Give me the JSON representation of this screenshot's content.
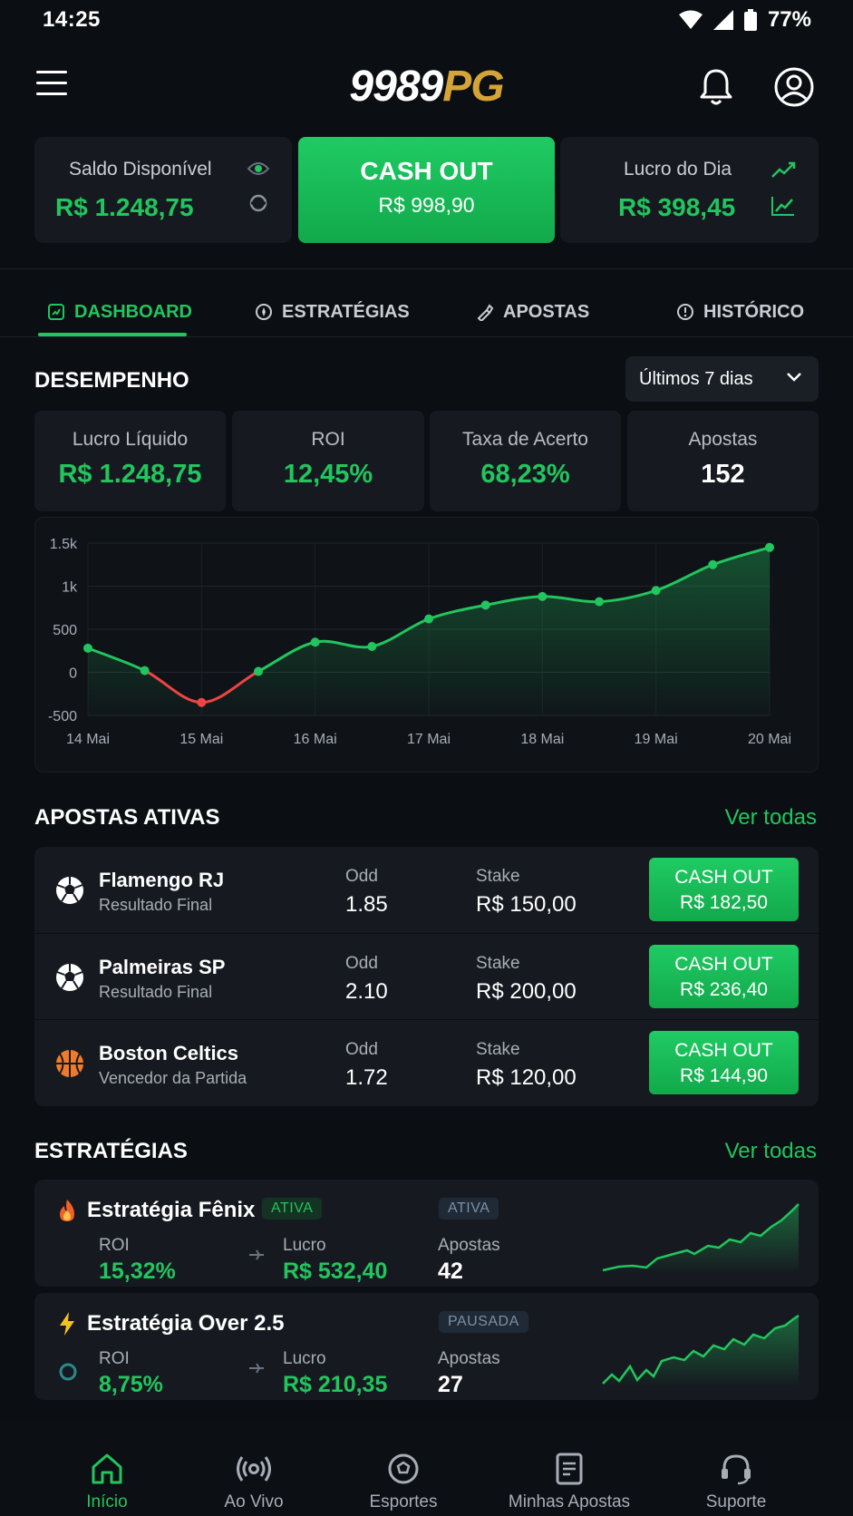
{
  "status": {
    "time": "14:25",
    "battery": "77%"
  },
  "header": {
    "logo_main": "9989",
    "logo_accent": "PG"
  },
  "top_cards": {
    "saldo_label": "Saldo Disponível",
    "saldo_value": "R$ 1.248,75",
    "cashout_label": "CASH OUT",
    "cashout_value": "R$ 998,90",
    "lucro_label": "Lucro do Dia",
    "lucro_value": "R$ 398,45"
  },
  "tabs": [
    {
      "label": "DASHBOARD",
      "active": true
    },
    {
      "label": "ESTRATÉGIAS"
    },
    {
      "label": "APOSTAS"
    },
    {
      "label": "HISTÓRICO"
    }
  ],
  "performance": {
    "title": "DESEMPENHO",
    "period": "Últimos 7 dias",
    "stats": [
      {
        "label": "Lucro Líquido",
        "value": "R$ 1.248,75",
        "color": "#22c55e"
      },
      {
        "label": "ROI",
        "value": "12,45%",
        "color": "#22c55e"
      },
      {
        "label": "Taxa de Acerto",
        "value": "68,23%",
        "color": "#22c55e"
      },
      {
        "label": "Apostas",
        "value": "152",
        "color": "#ffffff"
      }
    ]
  },
  "chart_data": {
    "type": "area",
    "title": "",
    "xlabel": "",
    "ylabel": "",
    "ylim": [
      -500,
      1500
    ],
    "yticks": [
      "1.5k",
      "1k",
      "500",
      "0",
      "-500"
    ],
    "ytick_values": [
      1500,
      1000,
      500,
      0,
      -500
    ],
    "x_tick_labels": [
      "14 Mai",
      "15 Mai",
      "16 Mai",
      "17 Mai",
      "18 Mai",
      "19 Mai",
      "20 Mai"
    ],
    "x": [
      0,
      0.5,
      1,
      1.5,
      2,
      2.5,
      3,
      3.5,
      4,
      4.5,
      5,
      5.5,
      6
    ],
    "values": [
      280,
      20,
      -350,
      10,
      350,
      300,
      620,
      780,
      880,
      820,
      950,
      1250,
      1450
    ],
    "colors": {
      "positive": "#22c55e",
      "negative": "#ef4444"
    },
    "grid": true
  },
  "active_bets": {
    "title": "APOSTAS ATIVAS",
    "see_all": "Ver todas",
    "odd_label": "Odd",
    "stake_label": "Stake",
    "items": [
      {
        "team": "Flamengo RJ",
        "market": "Resultado Final",
        "odd": "1.85",
        "stake": "R$ 150,00",
        "btn": "CASH OUT",
        "btn_value": "R$ 182,50",
        "icon": "soccer-ball-icon"
      },
      {
        "team": "Palmeiras SP",
        "market": "Resultado Final",
        "odd": "2.10",
        "stake": "R$ 200,00",
        "btn": "CASH OUT",
        "btn_value": "R$ 236,40",
        "icon": "soccer-ball-icon"
      },
      {
        "team": "Boston Celtics",
        "market": "Vencedor da Partida",
        "odd": "1.72",
        "stake": "R$ 120,00",
        "btn": "CASH OUT",
        "btn_value": "R$ 144,90",
        "icon": "basketball-icon"
      }
    ]
  },
  "strategies": {
    "title": "ESTRATÉGIAS",
    "see_all": "Ver todas",
    "roi_label": "ROI",
    "lucro_label": "Lucro",
    "apostas_label": "Apostas",
    "items": [
      {
        "name": "Estratégia Fênix",
        "badge_inline": "ATIVA",
        "status": "ATIVA",
        "roi": "15,32%",
        "lucro": "R$ 532,40",
        "apostas": "42",
        "icon": "fire-icon"
      },
      {
        "name": "Estratégia Over 2.5",
        "status": "PAUSADA",
        "roi": "8,75%",
        "lucro": "R$ 210,35",
        "apostas": "27",
        "icon": "lightning-icon"
      }
    ]
  },
  "bottom_nav": [
    {
      "label": "Início",
      "active": true
    },
    {
      "label": "Ao Vivo"
    },
    {
      "label": "Esportes"
    },
    {
      "label": "Minhas Apostas"
    },
    {
      "label": "Suporte"
    }
  ]
}
